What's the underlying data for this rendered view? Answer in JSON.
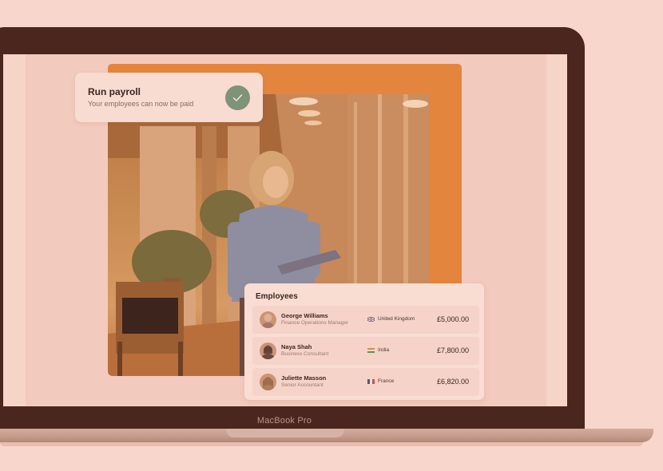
{
  "payroll": {
    "title": "Run payroll",
    "subtitle": "Your employees can now be paid",
    "icon": "check-icon"
  },
  "employees": {
    "title": "Employees",
    "rows": [
      {
        "name": "George Williams",
        "role": "Finance Operations Manager",
        "country": "United Kingdom",
        "flag": "uk-flag-icon",
        "amount": "£5,000.00"
      },
      {
        "name": "Naya Shah",
        "role": "Business Consultant",
        "country": "India",
        "flag": "india-flag-icon",
        "amount": "£7,800.00"
      },
      {
        "name": "Juliette Masson",
        "role": "Senior Accountant",
        "country": "France",
        "flag": "france-flag-icon",
        "amount": "£6,820.00"
      }
    ]
  },
  "device": {
    "model": "MacBook Pro"
  },
  "colors": {
    "background": "#f8d6cb",
    "laptop_frame": "#4a261e",
    "accent_orange": "#e4853d",
    "check_green": "#7f927a"
  }
}
